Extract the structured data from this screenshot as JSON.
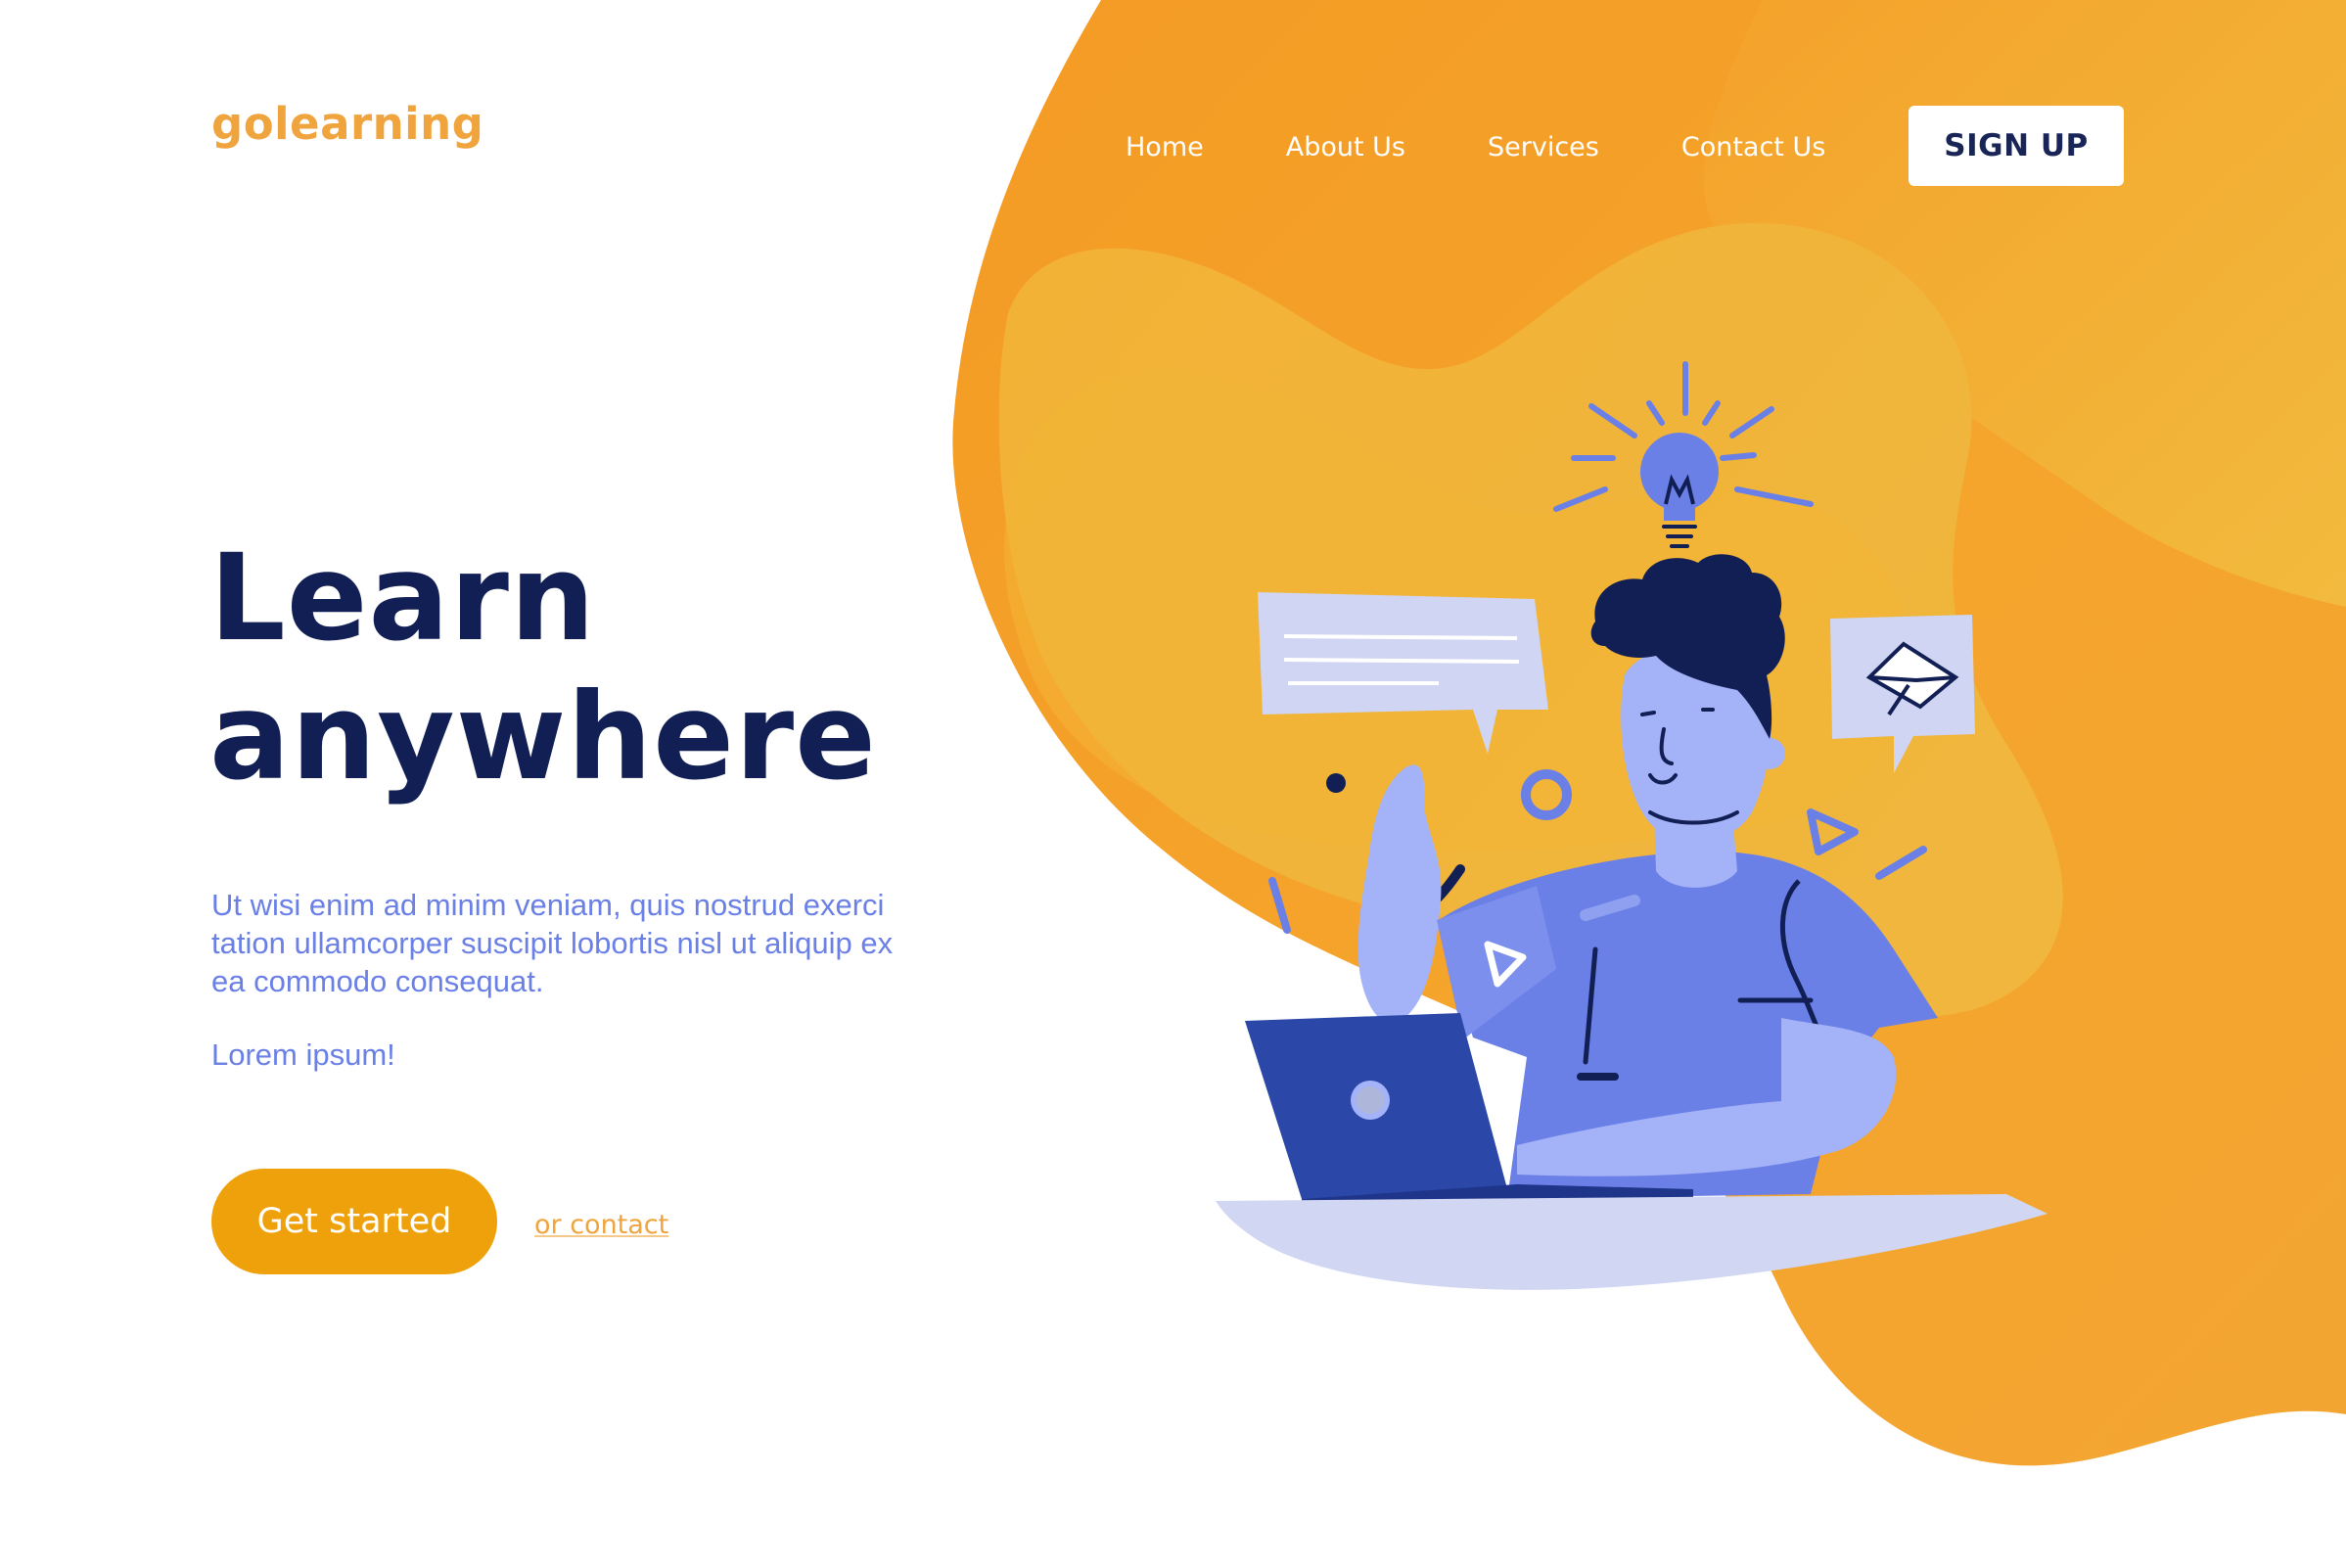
{
  "brand": {
    "logo_text": "golearning"
  },
  "nav": {
    "items": [
      "Home",
      "About Us",
      "Services",
      "Contact Us"
    ],
    "signup_label": "SIGN UP"
  },
  "hero": {
    "headline_line1": "Learn",
    "headline_line2": "anywhere",
    "body": "Ut wisi enim ad minim veniam, quis nostrud exerci tation ullamcorper suscipit lobortis nisl ut aliquip ex ea commodo consequat.",
    "tagline": "Lorem ipsum!",
    "cta_label": "Get started",
    "secondary_link": "or contact"
  },
  "illustration": {
    "icons": [
      "lightbulb-icon",
      "speech-bubble-icon",
      "envelope-icon",
      "play-icon",
      "laptop-icon"
    ]
  },
  "colors": {
    "accent_orange": "#EFA10B",
    "blob_orange": "#F5A32A",
    "blob_light": "#F1B73B",
    "navy": "#121F54",
    "periwinkle": "#6A80E6",
    "white": "#FFFFFF"
  }
}
